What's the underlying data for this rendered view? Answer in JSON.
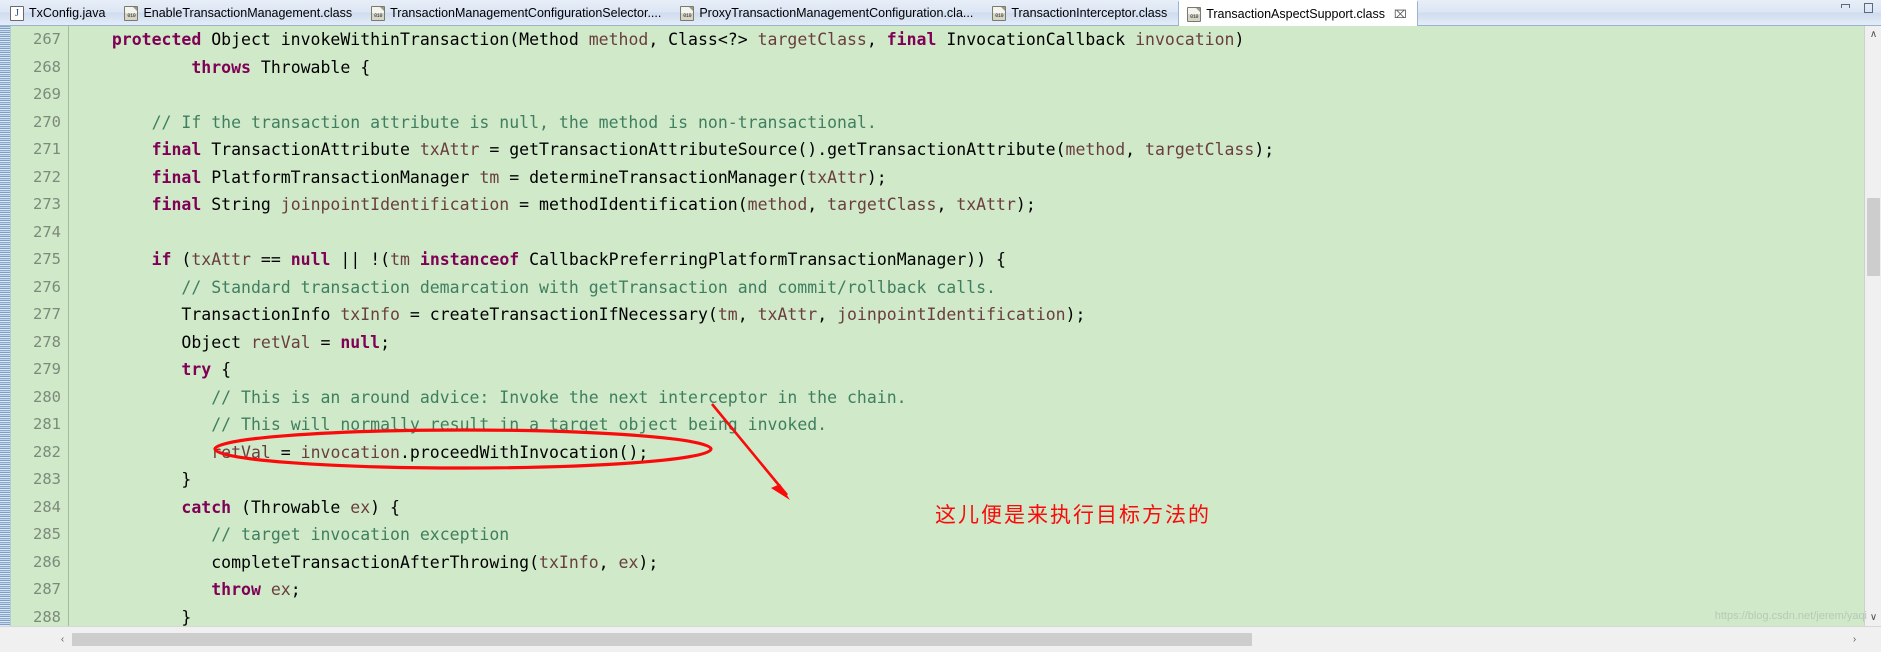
{
  "window": {
    "minimize_label": "Minimize",
    "maximize_label": "Maximize"
  },
  "tabs": [
    {
      "label": "TxConfig.java",
      "icon": "java-file-icon",
      "type": "java",
      "active": false,
      "closable": false
    },
    {
      "label": "EnableTransactionManagement.class",
      "icon": "class-file-icon",
      "type": "class",
      "active": false,
      "closable": false
    },
    {
      "label": "TransactionManagementConfigurationSelector....",
      "icon": "class-file-icon",
      "type": "class",
      "active": false,
      "closable": false
    },
    {
      "label": "ProxyTransactionManagementConfiguration.cla...",
      "icon": "class-file-icon",
      "type": "class",
      "active": false,
      "closable": false
    },
    {
      "label": "TransactionInterceptor.class",
      "icon": "class-file-icon",
      "type": "class",
      "active": false,
      "closable": false
    },
    {
      "label": "TransactionAspectSupport.class",
      "icon": "class-file-icon",
      "type": "class",
      "active": true,
      "closable": true,
      "close_label": "⌧"
    }
  ],
  "editor": {
    "line_numbers": [
      "267",
      "268",
      "269",
      "270",
      "271",
      "272",
      "273",
      "274",
      "275",
      "276",
      "277",
      "278",
      "279",
      "280",
      "281",
      "282",
      "283",
      "284",
      "285",
      "286",
      "287",
      "288"
    ],
    "fold_marker_on_line": "267",
    "lines": [
      {
        "n": "267",
        "tokens": [
          {
            "t": "  ",
            "c": "pln"
          },
          {
            "t": "protected",
            "c": "kw"
          },
          {
            "t": " Object invokeWithinTransaction(Method ",
            "c": "pln"
          },
          {
            "t": "method",
            "c": "fld"
          },
          {
            "t": ", Class<?> ",
            "c": "pln"
          },
          {
            "t": "targetClass",
            "c": "fld"
          },
          {
            "t": ", ",
            "c": "pln"
          },
          {
            "t": "final",
            "c": "kw"
          },
          {
            "t": " InvocationCallback ",
            "c": "pln"
          },
          {
            "t": "invocation",
            "c": "fld"
          },
          {
            "t": ")",
            "c": "pln"
          }
        ]
      },
      {
        "n": "268",
        "tokens": [
          {
            "t": "          ",
            "c": "pln"
          },
          {
            "t": "throws",
            "c": "kw"
          },
          {
            "t": " Throwable {",
            "c": "pln"
          }
        ]
      },
      {
        "n": "269",
        "tokens": [
          {
            "t": "",
            "c": "pln"
          }
        ]
      },
      {
        "n": "270",
        "tokens": [
          {
            "t": "      ",
            "c": "pln"
          },
          {
            "t": "// If the transaction attribute is null, the method is non-transactional.",
            "c": "cmt"
          }
        ]
      },
      {
        "n": "271",
        "tokens": [
          {
            "t": "      ",
            "c": "pln"
          },
          {
            "t": "final",
            "c": "kw"
          },
          {
            "t": " TransactionAttribute ",
            "c": "pln"
          },
          {
            "t": "txAttr",
            "c": "fld"
          },
          {
            "t": " = getTransactionAttributeSource().getTransactionAttribute(",
            "c": "pln"
          },
          {
            "t": "method",
            "c": "fld"
          },
          {
            "t": ", ",
            "c": "pln"
          },
          {
            "t": "targetClass",
            "c": "fld"
          },
          {
            "t": ");",
            "c": "pln"
          }
        ]
      },
      {
        "n": "272",
        "tokens": [
          {
            "t": "      ",
            "c": "pln"
          },
          {
            "t": "final",
            "c": "kw"
          },
          {
            "t": " PlatformTransactionManager ",
            "c": "pln"
          },
          {
            "t": "tm",
            "c": "fld"
          },
          {
            "t": " = determineTransactionManager(",
            "c": "pln"
          },
          {
            "t": "txAttr",
            "c": "fld"
          },
          {
            "t": ");",
            "c": "pln"
          }
        ]
      },
      {
        "n": "273",
        "tokens": [
          {
            "t": "      ",
            "c": "pln"
          },
          {
            "t": "final",
            "c": "kw"
          },
          {
            "t": " String ",
            "c": "pln"
          },
          {
            "t": "joinpointIdentification",
            "c": "fld"
          },
          {
            "t": " = methodIdentification(",
            "c": "pln"
          },
          {
            "t": "method",
            "c": "fld"
          },
          {
            "t": ", ",
            "c": "pln"
          },
          {
            "t": "targetClass",
            "c": "fld"
          },
          {
            "t": ", ",
            "c": "pln"
          },
          {
            "t": "txAttr",
            "c": "fld"
          },
          {
            "t": ");",
            "c": "pln"
          }
        ]
      },
      {
        "n": "274",
        "tokens": [
          {
            "t": "",
            "c": "pln"
          }
        ]
      },
      {
        "n": "275",
        "tokens": [
          {
            "t": "      ",
            "c": "pln"
          },
          {
            "t": "if",
            "c": "kw"
          },
          {
            "t": " (",
            "c": "pln"
          },
          {
            "t": "txAttr",
            "c": "fld"
          },
          {
            "t": " == ",
            "c": "pln"
          },
          {
            "t": "null",
            "c": "kw"
          },
          {
            "t": " || !(",
            "c": "pln"
          },
          {
            "t": "tm",
            "c": "fld"
          },
          {
            "t": " ",
            "c": "pln"
          },
          {
            "t": "instanceof",
            "c": "kw"
          },
          {
            "t": " CallbackPreferringPlatformTransactionManager)) {",
            "c": "pln"
          }
        ]
      },
      {
        "n": "276",
        "tokens": [
          {
            "t": "         ",
            "c": "pln"
          },
          {
            "t": "// Standard transaction demarcation with getTransaction and commit/rollback calls.",
            "c": "cmt"
          }
        ]
      },
      {
        "n": "277",
        "tokens": [
          {
            "t": "         ",
            "c": "pln"
          },
          {
            "t": "TransactionInfo ",
            "c": "pln"
          },
          {
            "t": "txInfo",
            "c": "fld"
          },
          {
            "t": " = createTransactionIfNecessary(",
            "c": "pln"
          },
          {
            "t": "tm",
            "c": "fld"
          },
          {
            "t": ", ",
            "c": "pln"
          },
          {
            "t": "txAttr",
            "c": "fld"
          },
          {
            "t": ", ",
            "c": "pln"
          },
          {
            "t": "joinpointIdentification",
            "c": "fld"
          },
          {
            "t": ");",
            "c": "pln"
          }
        ]
      },
      {
        "n": "278",
        "tokens": [
          {
            "t": "         Object ",
            "c": "pln"
          },
          {
            "t": "retVal",
            "c": "fld"
          },
          {
            "t": " = ",
            "c": "pln"
          },
          {
            "t": "null",
            "c": "kw"
          },
          {
            "t": ";",
            "c": "pln"
          }
        ]
      },
      {
        "n": "279",
        "tokens": [
          {
            "t": "         ",
            "c": "pln"
          },
          {
            "t": "try",
            "c": "kw"
          },
          {
            "t": " {",
            "c": "pln"
          }
        ]
      },
      {
        "n": "280",
        "tokens": [
          {
            "t": "            ",
            "c": "pln"
          },
          {
            "t": "// This is an around advice: Invoke the next interceptor in the chain.",
            "c": "cmt"
          }
        ]
      },
      {
        "n": "281",
        "tokens": [
          {
            "t": "            ",
            "c": "pln"
          },
          {
            "t": "// This will normally result in a target object being invoked.",
            "c": "cmt"
          }
        ]
      },
      {
        "n": "282",
        "tokens": [
          {
            "t": "            ",
            "c": "pln"
          },
          {
            "t": "retVal",
            "c": "fld"
          },
          {
            "t": " = ",
            "c": "pln"
          },
          {
            "t": "invocation",
            "c": "fld"
          },
          {
            "t": ".proceedWithInvocation();",
            "c": "pln"
          }
        ]
      },
      {
        "n": "283",
        "tokens": [
          {
            "t": "         }",
            "c": "pln"
          }
        ]
      },
      {
        "n": "284",
        "tokens": [
          {
            "t": "         ",
            "c": "pln"
          },
          {
            "t": "catch",
            "c": "kw"
          },
          {
            "t": " (Throwable ",
            "c": "pln"
          },
          {
            "t": "ex",
            "c": "fld"
          },
          {
            "t": ") {",
            "c": "pln"
          }
        ]
      },
      {
        "n": "285",
        "tokens": [
          {
            "t": "            ",
            "c": "pln"
          },
          {
            "t": "// target invocation exception",
            "c": "cmt"
          }
        ]
      },
      {
        "n": "286",
        "tokens": [
          {
            "t": "            completeTransactionAfterThrowing(",
            "c": "pln"
          },
          {
            "t": "txInfo",
            "c": "fld"
          },
          {
            "t": ", ",
            "c": "pln"
          },
          {
            "t": "ex",
            "c": "fld"
          },
          {
            "t": ");",
            "c": "pln"
          }
        ]
      },
      {
        "n": "287",
        "tokens": [
          {
            "t": "            ",
            "c": "pln"
          },
          {
            "t": "throw",
            "c": "kw"
          },
          {
            "t": " ",
            "c": "pln"
          },
          {
            "t": "ex",
            "c": "fld"
          },
          {
            "t": ";",
            "c": "pln"
          }
        ]
      },
      {
        "n": "288",
        "tokens": [
          {
            "t": "         }",
            "c": "pln"
          }
        ]
      }
    ]
  },
  "annotations": {
    "highlight_color": "#fa0a0a",
    "ellipse_target_line": "282",
    "note_text": "这儿便是来执行目标方法的"
  },
  "watermark": {
    "text": "https://blog.csdn.net/jerem/yaqi"
  },
  "scrollbars": {
    "vertical": {
      "up_arrow": "∧",
      "down_arrow": "∨"
    },
    "horizontal": {
      "left_arrow": "‹",
      "right_arrow": "›"
    }
  },
  "colors": {
    "editor_background": "#cfe9c9",
    "keyword": "#7f0055",
    "comment": "#3f7f5f",
    "field": "#6a3e3e",
    "annotation_red": "#fa0a0a"
  }
}
